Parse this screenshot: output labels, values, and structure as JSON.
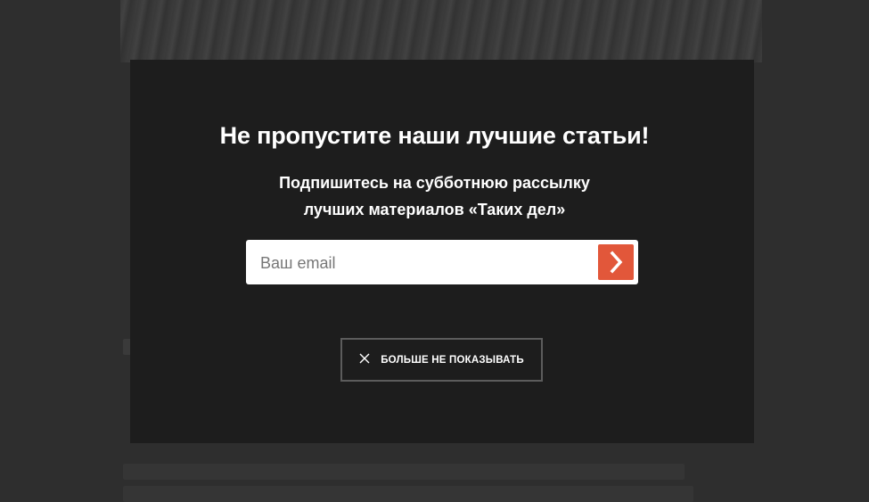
{
  "modal": {
    "title": "Не пропустите наши лучшие статьи!",
    "subtitle_line1": "Подпишитесь на субботнюю рассылку",
    "subtitle_line2": "лучших материалов «Таких дел»",
    "email_placeholder": "Ваш email",
    "submit_icon": "chevron-right-icon",
    "dismiss_label": "БОЛЬШЕ НЕ ПОКАЗЫВАТЬ",
    "dismiss_icon": "close-icon"
  },
  "colors": {
    "accent": "#e2573a",
    "modal_bg": "#1d1d1d",
    "overlay_bg": "#2e2e2e"
  }
}
